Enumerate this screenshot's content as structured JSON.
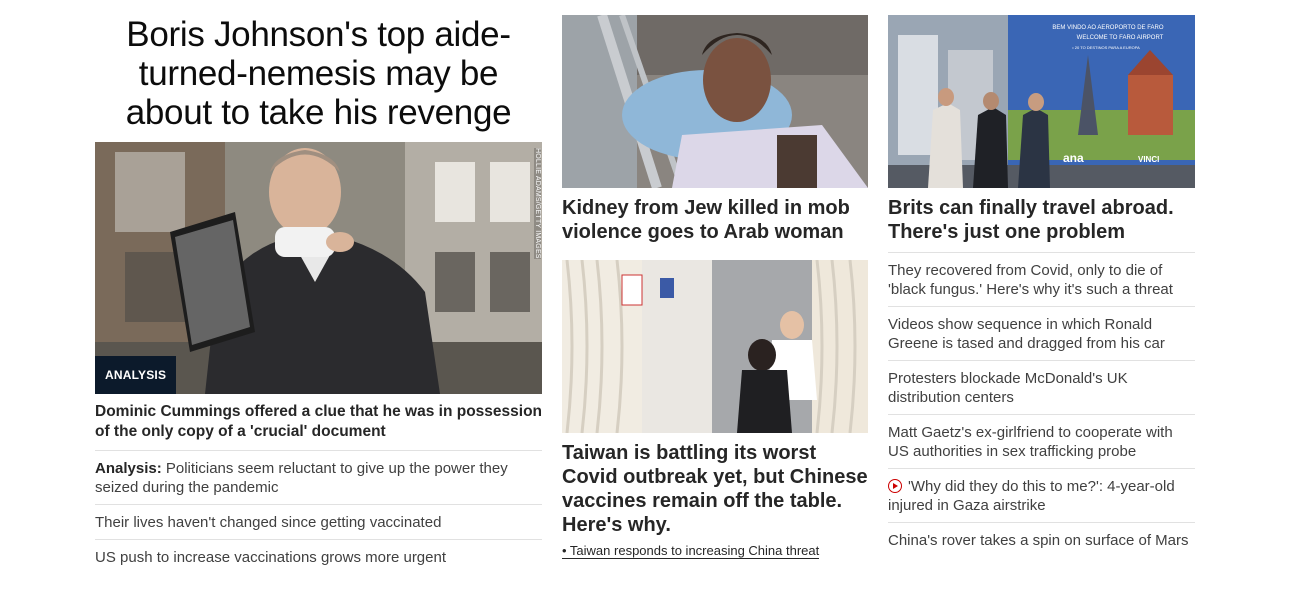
{
  "lead": {
    "headline": "Boris Johnson's top aide-turned-nemesis may be about to take his revenge",
    "badge": "ANALYSIS",
    "photo_credit": "HOLLIE ADAMS/GETTY IMAGES",
    "subhead": "Dominic Cummings offered a clue that he was in possession of the only copy of a 'crucial' document",
    "related": [
      {
        "prefix": "Analysis:",
        "text": " Politicians seem reluctant to give up the power they seized during the pandemic"
      },
      {
        "prefix": "",
        "text": "Their lives haven't changed since getting vaccinated"
      },
      {
        "prefix": "",
        "text": "US push to increase vaccinations grows more urgent"
      }
    ]
  },
  "middle": {
    "card1": {
      "title": "Kidney from Jew killed in mob violence goes to Arab woman"
    },
    "card2": {
      "title": "Taiwan is battling its worst Covid outbreak yet, but Chinese vaccines remain off the table. Here's why.",
      "related": "• Taiwan responds to increasing China threat"
    }
  },
  "right": {
    "card": {
      "title": "Brits can finally travel abroad. There's just one problem",
      "sign_line1": "BEM VINDO AO AEROPORTO DE FARO",
      "sign_line2": "WELCOME TO FARO AIRPORT",
      "sign_line3": "• 20 TO DESTINOS PARA A EUROPA",
      "sign_brand": "ana",
      "sign_brand2": "VINCI"
    },
    "headlines": [
      {
        "text": "They recovered from Covid, only to die of 'black fungus.' Here's why it's such a threat",
        "video": false
      },
      {
        "text": "Videos show sequence in which Ronald Greene is tased and dragged from his car",
        "video": false
      },
      {
        "text": "Protesters blockade McDonald's UK distribution centers",
        "video": false
      },
      {
        "text": "Matt Gaetz's ex-girlfriend to cooperate with US authorities in sex trafficking probe",
        "video": false
      },
      {
        "text": "'Why did they do this to me?': 4-year-old injured in Gaza airstrike",
        "video": true
      },
      {
        "text": "China's rover takes a spin on surface of Mars",
        "video": false
      }
    ]
  },
  "colors": {
    "badge_bg": "#0c1a2b",
    "video_icon": "#cc0000",
    "divider": "#e1e1e1"
  }
}
